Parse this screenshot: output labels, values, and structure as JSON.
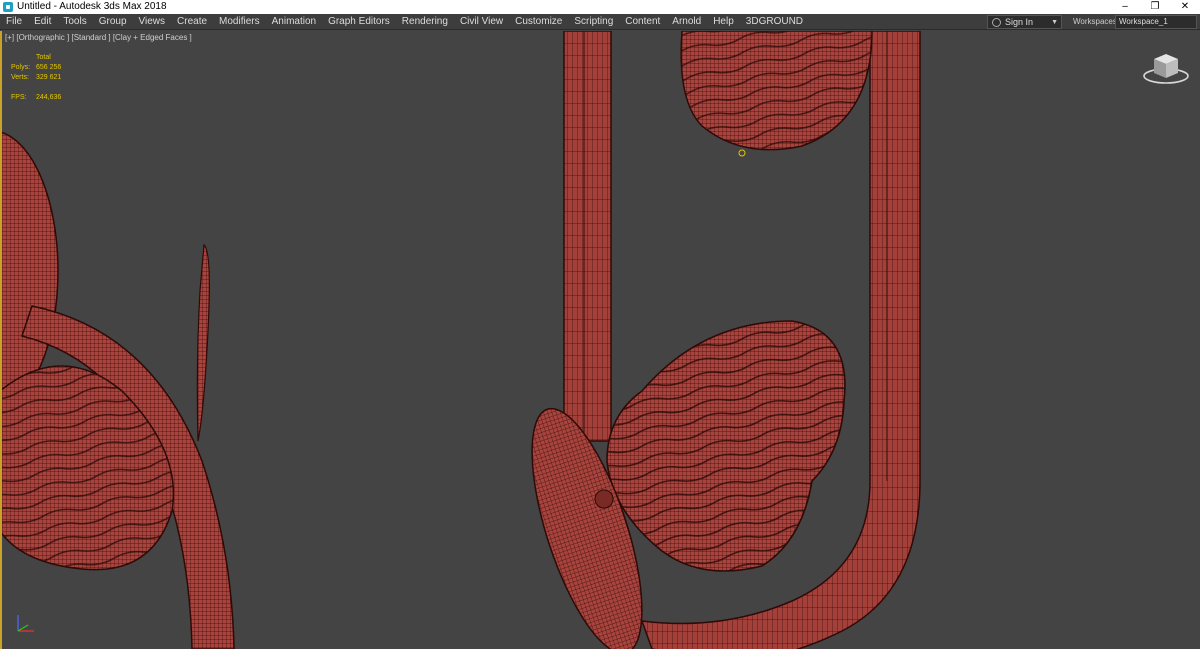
{
  "window": {
    "title": "Untitled - Autodesk 3ds Max 2018",
    "controls": {
      "minimize": "–",
      "restore": "❐",
      "close": "✕"
    }
  },
  "menubar": {
    "items": [
      "File",
      "Edit",
      "Tools",
      "Group",
      "Views",
      "Create",
      "Modifiers",
      "Animation",
      "Graph Editors",
      "Rendering",
      "Civil View",
      "Customize",
      "Scripting",
      "Content",
      "Arnold",
      "Help",
      "3DGROUND"
    ],
    "sign_in": "Sign In",
    "workspaces_label": "Workspaces:",
    "workspace_value": "Workspace_1"
  },
  "viewport": {
    "label": "[+] [Orthographic ] [Standard ] [Clay + Edged Faces ]",
    "stats": {
      "heading": "Total",
      "polys_label": "Polys:",
      "polys_value": "656 256",
      "verts_label": "Verts:",
      "verts_value": "329 621",
      "fps_label": "FPS:",
      "fps_value": "244,636"
    },
    "colors": {
      "background": "#444444",
      "mesh_fill": "#a8443d",
      "wire": "#3a0d0b",
      "active_border": "#c9a227",
      "stats_text": "#e3c600"
    }
  }
}
